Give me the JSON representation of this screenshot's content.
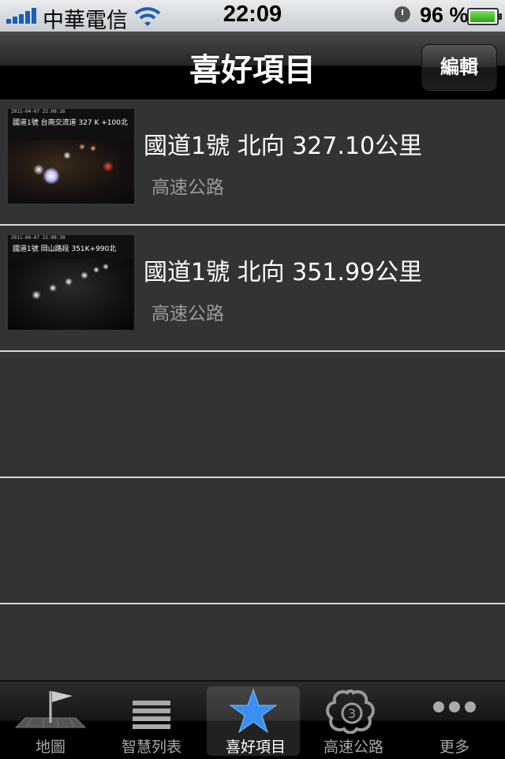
{
  "status_bar": {
    "carrier": "中華電信",
    "time": "22:09",
    "battery_percent": "96 %",
    "battery_level": 0.96
  },
  "nav": {
    "title": "喜好項目",
    "edit_label": "編輯"
  },
  "favorites": [
    {
      "title": "國道1號 北向 327.10公里",
      "subtitle": "高速公路",
      "thumb_caption": "國道1號 台南交流道 327 K +100北",
      "thumb_timestamp": "2011-04-07 22:09:16"
    },
    {
      "title": "國道1號 北向 351.99公里",
      "subtitle": "高速公路",
      "thumb_caption": "國道1號 岡山路段 351K+990北",
      "thumb_timestamp": "2011-04-07 22:09:30"
    }
  ],
  "tabs": [
    {
      "label": "地圖",
      "icon": "map-flag-icon"
    },
    {
      "label": "智慧列表",
      "icon": "list-icon"
    },
    {
      "label": "喜好項目",
      "icon": "star-icon",
      "selected": true
    },
    {
      "label": "高速公路",
      "icon": "highway-shield-icon"
    },
    {
      "label": "更多",
      "icon": "more-icon"
    }
  ],
  "colors": {
    "accent_star": "#3a8ff0",
    "list_background": "#333333",
    "separator": "#d7d7d7"
  }
}
